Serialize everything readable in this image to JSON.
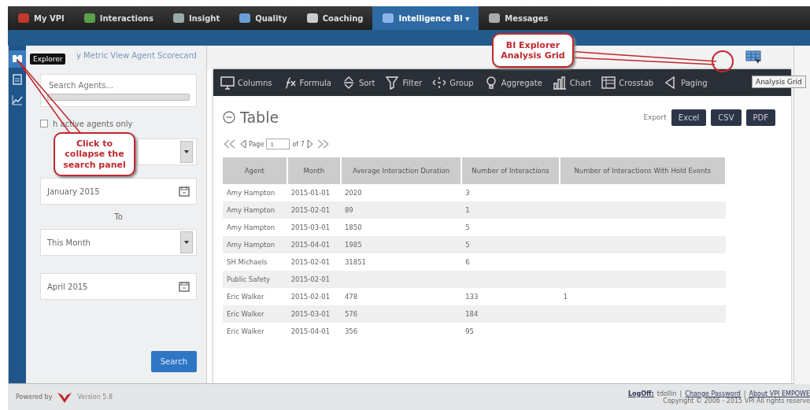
{
  "nav": [
    {
      "label": "My VPI",
      "selected": false
    },
    {
      "label": "Interactions",
      "selected": false
    },
    {
      "label": "Insight",
      "selected": false
    },
    {
      "label": "Quality",
      "selected": false
    },
    {
      "label": "Coaching",
      "selected": false
    },
    {
      "label": "Intelligence BI ▾",
      "selected": true
    },
    {
      "label": "Messages",
      "selected": false
    }
  ],
  "side_icons": [
    {
      "kind": "explore",
      "selected": true
    },
    {
      "kind": "report",
      "selected": false
    },
    {
      "kind": "trend",
      "selected": false
    }
  ],
  "breadcrumb": "y Metric View Agent Scorecard",
  "tooltips": {
    "explorer": "Explorer",
    "analysis_grid": "Analysis Grid"
  },
  "search_panel": {
    "search": {
      "placeholder": "Search Agents..."
    },
    "active_only": {
      "label": "h active agents only",
      "checked": false
    },
    "from": "January 2015",
    "to_label": "To",
    "to_range": "This Month",
    "to": "April 2015",
    "button": "Search"
  },
  "callouts": {
    "collapse": "Click to collapse the search panel",
    "grid": "BI Explorer Analysis Grid"
  },
  "toolbar": [
    "Columns",
    "Formula",
    "Sort",
    "Filter",
    "Group",
    "Aggregate",
    "Chart",
    "Crosstab",
    "Paging"
  ],
  "table_title": "Table",
  "export": {
    "label": "Export",
    "buttons": [
      "Excel",
      "CSV",
      "PDF"
    ]
  },
  "pager": {
    "label": "Page",
    "value": "1",
    "of": "of 7"
  },
  "table": {
    "columns": [
      "Agent",
      "Month",
      "Average Interaction Duration",
      "Number of Interactions",
      "Number of Interactions With Hold Events"
    ],
    "rows": [
      [
        "Amy Hampton",
        "2015-01-01",
        "2020",
        "3",
        ""
      ],
      [
        "Amy Hampton",
        "2015-02-01",
        "89",
        "1",
        ""
      ],
      [
        "Amy Hampton",
        "2015-03-01",
        "1850",
        "5",
        ""
      ],
      [
        "Amy Hampton",
        "2015-04-01",
        "1985",
        "5",
        ""
      ],
      [
        "SH Michaels",
        "2015-02-01",
        "31851",
        "6",
        ""
      ],
      [
        "Public Safety",
        "2015-02-01",
        "",
        "",
        ""
      ],
      [
        "Eric Walker",
        "2015-02-01",
        "478",
        "133",
        "1"
      ],
      [
        "Eric Walker",
        "2015-03-01",
        "576",
        "184",
        ""
      ],
      [
        "Eric Walker",
        "2015-04-01",
        "356",
        "95",
        ""
      ]
    ]
  },
  "footer": {
    "separator": "|",
    "powered": "Powered by",
    "version": "Version 5.8",
    "logoff": "LogOff:",
    "user": "tdollin",
    "links": [
      "Change Password",
      "About VPI EMPOWE"
    ],
    "copyright": "Copyright © 2006 - 2015 VPI All rights reserve"
  }
}
